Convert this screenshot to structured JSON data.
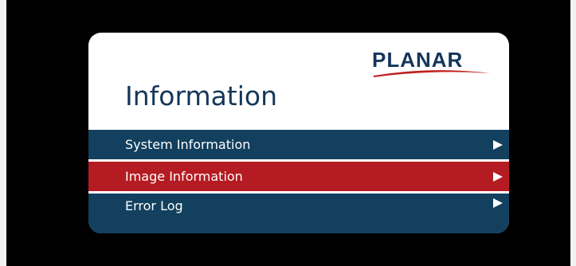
{
  "brand": {
    "logo_text": "PLANAR"
  },
  "panel": {
    "title": "Information"
  },
  "menu": {
    "items": [
      {
        "label": "System Information",
        "state": "default"
      },
      {
        "label": "Image Information",
        "state": "selected"
      },
      {
        "label": "Error Log",
        "state": "default"
      }
    ]
  },
  "colors": {
    "page_background": "#f2f2f2",
    "screen_background": "#000000",
    "panel_background": "#ffffff",
    "title_text": "#14365a",
    "logo_text": "#14365a",
    "logo_swoosh": "#c0201f",
    "menu_default": "#12405e",
    "menu_selected": "#b51b22",
    "menu_text": "#ffffff"
  },
  "icons": {
    "menu_arrow": "triangle-right-icon"
  }
}
